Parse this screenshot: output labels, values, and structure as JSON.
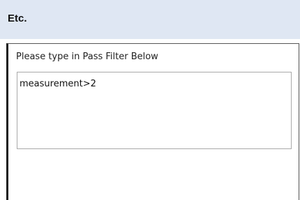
{
  "panel": {
    "title": "Etc."
  },
  "filter": {
    "label": "Please type in Pass Filter Below",
    "value": "measurement>2"
  }
}
